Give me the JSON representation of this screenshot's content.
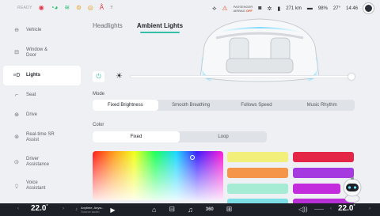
{
  "statusbar": {
    "ready_label": "READY",
    "airbag_line1": "PASSENGER",
    "airbag_line2": "AIRBAG",
    "airbag_state": "OFF",
    "range": "271 km",
    "battery": "98%",
    "outside_temp": "27°",
    "time": "14:46",
    "icons": [
      "steering-wheel-warning-icon",
      "door-open-icon",
      "headlight-icon",
      "seatbelt-icon",
      "abs-icon",
      "traction-icon",
      "navigation-icon",
      "airbag-icon",
      "camera-icon",
      "bluetooth-icon",
      "signal-icon",
      "battery-icon",
      "user-icon"
    ]
  },
  "sidebar": {
    "items": [
      {
        "label": "Vehicle",
        "icon": "car-icon"
      },
      {
        "label": "Window & Door",
        "icon": "window-icon"
      },
      {
        "label": "Lights",
        "icon": "lights-icon"
      },
      {
        "label": "Seat",
        "icon": "seat-icon"
      },
      {
        "label": "Drive",
        "icon": "steering-icon"
      },
      {
        "label": "Real-time SR Assist",
        "icon": "radar-icon"
      },
      {
        "label": "Driver Assistance",
        "icon": "assist-icon"
      },
      {
        "label": "Voice Assistant",
        "icon": "voice-icon"
      }
    ],
    "active_index": 2
  },
  "tabs": [
    {
      "label": "Headlights",
      "active": false
    },
    {
      "label": "Ambient Lights",
      "active": true
    }
  ],
  "brightness": {
    "power_on": true,
    "level": 1.0
  },
  "mode": {
    "label": "Mode",
    "options": [
      "Fixed Brightness",
      "Smooth Breathing",
      "Follows Speed",
      "Music Rhythm"
    ],
    "selected": "Fixed Brightness"
  },
  "color": {
    "label": "Color",
    "options": [
      "Fixed",
      "Loop"
    ],
    "selected": "Fixed",
    "swatches": [
      "#f2ef7a",
      "#e42545",
      "#f4954a",
      "#a53ae0",
      "#a6ecd4",
      "#c22cdc",
      "#7ddfe6",
      "#b830d6"
    ],
    "accent": "#34c0a6"
  },
  "bottombar": {
    "left_temp": "22.0",
    "right_temp": "22.0",
    "media_title": "Anytime, Anyw...",
    "media_subtitle": "Source audio"
  }
}
